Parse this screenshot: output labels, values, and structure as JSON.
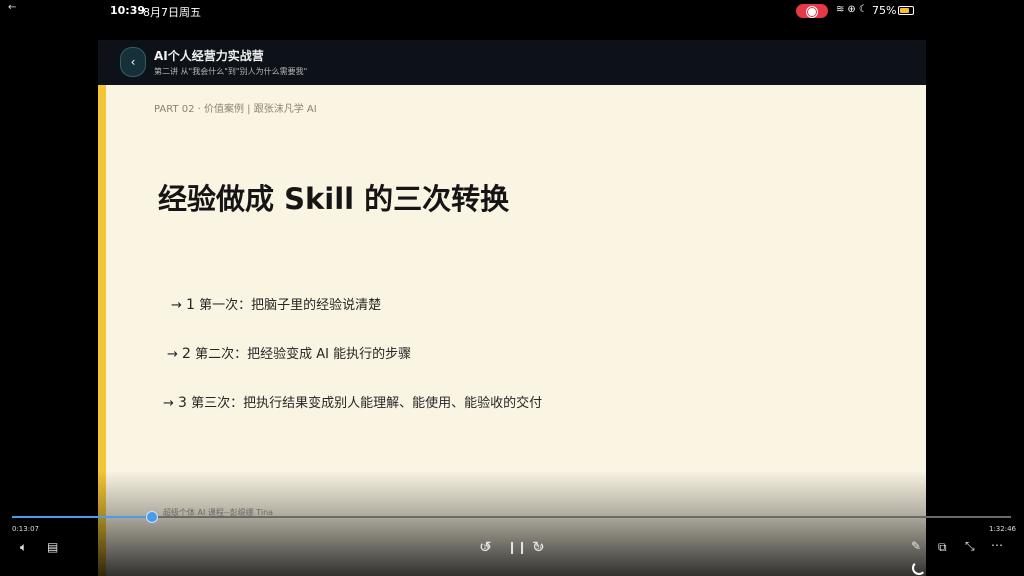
{
  "status_bar": {
    "time": "10:39",
    "date": "8月7日周五",
    "battery": "75%"
  },
  "header": {
    "title": "AI个人经营力实战营",
    "subtitle": "第二讲 从\"我会什么\"到\"别人为什么需要我\""
  },
  "slide": {
    "part": "PART 02 · 价值案例 | 跟张沫凡学 AI",
    "title": "经验做成 Skill 的三次转换",
    "steps": [
      {
        "arrow": "→",
        "num": "1",
        "text": "第一次：把脑子里的经验说清楚"
      },
      {
        "arrow": "→",
        "num": "2",
        "text": "第二次：把经验变成 AI 能执行的步骤"
      },
      {
        "arrow": "→",
        "num": "3",
        "text": "第三次：把执行结果变成别人能理解、能使用、能验收的交付"
      }
    ],
    "footer": "超级个体 AI 课程--彭缇娜 Tina"
  },
  "player": {
    "current_time": "0:13:07",
    "total_time": "1:32:46",
    "progress": 0.14,
    "skip_back_seconds": "10",
    "skip_forward_seconds": "30"
  },
  "colors": {
    "slide_bg": "#faf4e3",
    "accent_bar": "#f2c634",
    "progress": "#4a9be8",
    "record": "#e5394a"
  }
}
